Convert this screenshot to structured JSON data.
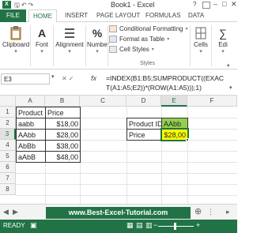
{
  "window": {
    "title": "Book1 - Excel",
    "help": "?"
  },
  "tabs": [
    "FILE",
    "HOME",
    "INSERT",
    "PAGE LAYOUT",
    "FORMULAS",
    "DATA"
  ],
  "ribbon": {
    "clipboard": "Clipboard",
    "font": "Font",
    "alignment": "Alignment",
    "number": "Number",
    "conditional_formatting": "Conditional Formatting",
    "format_as_table": "Format as Table",
    "cell_styles": "Cell Styles",
    "styles_group": "Styles",
    "cells": "Cells",
    "editing": "Edi"
  },
  "formula_bar": {
    "name_box": "E3",
    "fx": "fx",
    "formula": "=INDEX(B1:B5;SUMPRODUCT((EXACT(A1:A5;E2))*(ROW(A1:A5)));1)"
  },
  "columns": [
    "A",
    "B",
    "C",
    "D",
    "E",
    "F"
  ],
  "rows": [
    "1",
    "2",
    "3",
    "4",
    "5",
    "6",
    "7",
    "8"
  ],
  "table": {
    "headers": [
      "Product ID",
      "Price"
    ],
    "rows": [
      [
        "aabb",
        "$18,00"
      ],
      [
        "AAbb",
        "$28,00"
      ],
      [
        "AbBb",
        "$38,00"
      ],
      [
        "aAbB",
        "$48,00"
      ]
    ]
  },
  "lookup": {
    "label_id": "Product ID",
    "value_id": "AAbb",
    "label_price": "Price",
    "value_price": "$28,00"
  },
  "sheet_bar": {
    "website": "www.Best-Excel-Tutorial.com"
  },
  "status": {
    "ready": "READY"
  },
  "colors": {
    "accent": "#217346",
    "header_green": "#92d050",
    "result_yellow": "#ffff00"
  }
}
